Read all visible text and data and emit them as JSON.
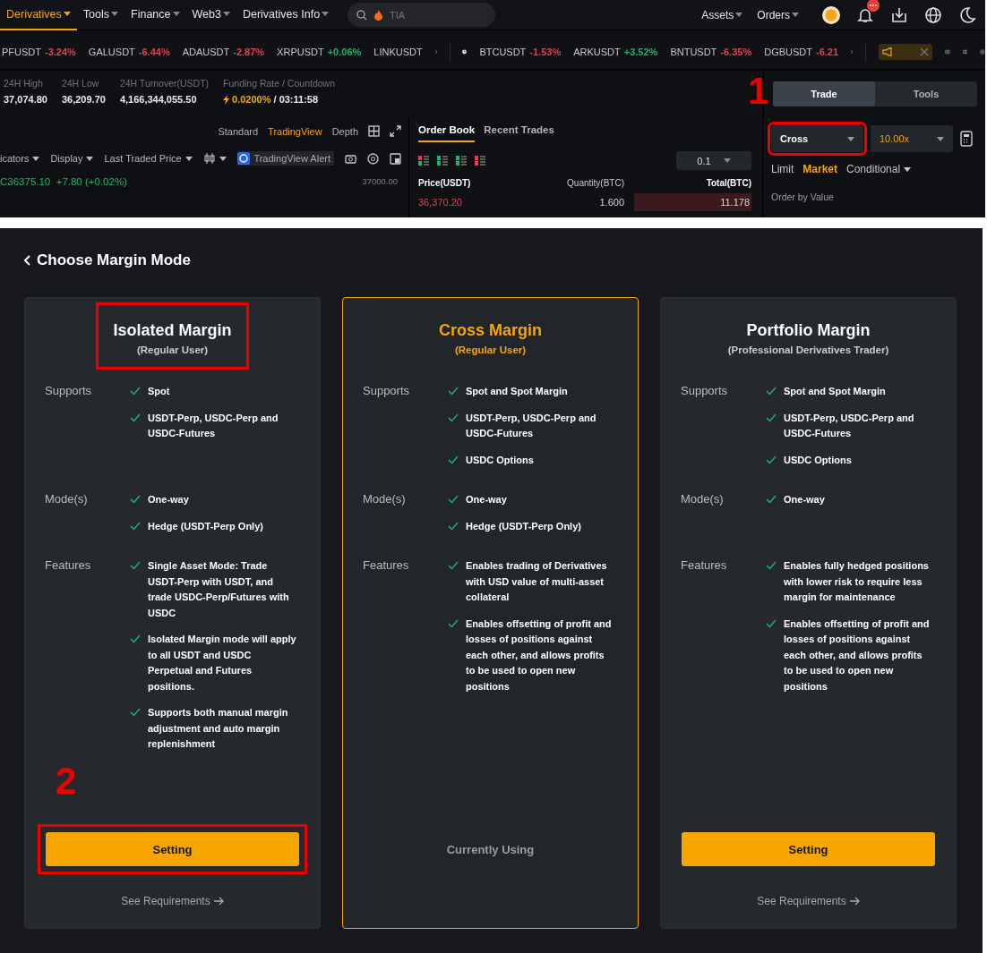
{
  "nav": {
    "menus": [
      {
        "label": "Derivatives",
        "selected": true
      },
      {
        "label": "Tools",
        "selected": false
      },
      {
        "label": "Finance",
        "selected": false
      },
      {
        "label": "Web3",
        "selected": false
      },
      {
        "label": "Derivatives Info",
        "selected": false
      }
    ],
    "search": {
      "placeholder": "TIA"
    },
    "right_menus": [
      {
        "label": "Assets"
      },
      {
        "label": "Orders"
      }
    ]
  },
  "ticker": {
    "items": [
      {
        "symbol": "PFUSDT",
        "change": "-3.24%",
        "color": "#e2404f"
      },
      {
        "symbol": "GALUSDT",
        "change": "-6.44%",
        "color": "#e2404f"
      },
      {
        "symbol": "ADAUSDT",
        "change": "-2.87%",
        "color": "#e2404f"
      },
      {
        "symbol": "XRPUSDT",
        "change": "+0.06%",
        "color": "#20b26c"
      },
      {
        "symbol": "LINKUSDT"
      }
    ],
    "pinned": [
      {
        "symbol": "BTCUSDT",
        "change": "-1.53%",
        "color": "#e2404f"
      },
      {
        "symbol": "ARKUSDT",
        "change": "+3.52%",
        "color": "#20b26c"
      },
      {
        "symbol": "BNTUSDT",
        "change": "-6.35%",
        "color": "#e2404f"
      },
      {
        "symbol": "DGBUSDT",
        "change": "-6.21",
        "color": "#e2404f"
      }
    ]
  },
  "stats": [
    {
      "label": "24H High",
      "value": "37,074.80"
    },
    {
      "label": "24H Low",
      "value": "36,209.70"
    },
    {
      "label": "24H Turnover(USDT)",
      "value": "4,166,344,055.50"
    }
  ],
  "funding": {
    "label": "Funding Rate / Countdown",
    "rate": "0.0200%",
    "countdown": "/ 03:11:58"
  },
  "chart": {
    "views": [
      {
        "label": "Standard",
        "selected": false
      },
      {
        "label": "TradingView",
        "selected": true
      },
      {
        "label": "Depth",
        "selected": false
      }
    ],
    "toolbar": [
      "icators",
      "Display",
      "Last Traded Price"
    ],
    "alert": "TradingView Alert",
    "close_label": "C",
    "close_value": "36375.10",
    "close_change": "+7.80 (+0.02%)",
    "axis_labels": [
      "37000.00"
    ]
  },
  "order_book": {
    "tabs": [
      {
        "label": "Order Book",
        "selected": true
      },
      {
        "label": "Recent Trades",
        "selected": false
      }
    ],
    "precision": "0.1",
    "columns": [
      "Price(USDT)",
      "Quantity(BTC)",
      "Total(BTC)"
    ],
    "rows": [
      {
        "price": "36,370.20",
        "quantity": "1.600",
        "total": "11.178"
      }
    ]
  },
  "order_panel": {
    "annotation": "1",
    "tabs": [
      {
        "label": "Trade",
        "selected": true
      },
      {
        "label": "Tools",
        "selected": false
      }
    ],
    "margin_mode": {
      "value": "Cross",
      "highlighted": true
    },
    "leverage": "10.00x",
    "order_types": [
      {
        "label": "Limit",
        "selected": false
      },
      {
        "label": "Market",
        "selected": true
      },
      {
        "label": "Conditional",
        "selected": false
      }
    ],
    "order_by": "Order by Value"
  },
  "margin_dialog": {
    "title": "Choose Margin Mode",
    "annotation": "2",
    "cards": [
      {
        "title": "Isolated Margin",
        "subtitle": "(Regular User)",
        "selected": false,
        "highlighted": true,
        "sections": [
          {
            "label": "Supports",
            "items": [
              "Spot",
              "USDT-Perp, USDC-Perp and USDC-Futures"
            ]
          },
          {
            "label": "Mode(s)",
            "items": [
              "One-way",
              "Hedge (USDT-Perp Only)"
            ]
          },
          {
            "label": "Features",
            "items": [
              "Single Asset Mode: Trade USDT-Perp with USDT, and trade USDC-Perp/Futures with USDC",
              "Isolated Margin mode will apply to all USDT and USDC Perpetual and Futures positions.",
              "Supports both manual margin adjustment and auto margin replenishment"
            ]
          }
        ],
        "action": {
          "kind": "button",
          "label": "Setting",
          "highlighted": true
        },
        "link": "See Requirements"
      },
      {
        "title": "Cross Margin",
        "subtitle": "(Regular User)",
        "selected": true,
        "highlighted": false,
        "sections": [
          {
            "label": "Supports",
            "items": [
              "Spot and Spot Margin",
              "USDT-Perp, USDC-Perp and USDC-Futures",
              "USDC Options"
            ]
          },
          {
            "label": "Mode(s)",
            "items": [
              "One-way",
              "Hedge (USDT-Perp Only)"
            ]
          },
          {
            "label": "Features",
            "items": [
              "Enables trading of Derivatives with USD value of multi-asset collateral",
              "Enables offsetting of profit and losses of positions against each other, and allows profits to be used to open new positions"
            ]
          }
        ],
        "action": {
          "kind": "status",
          "label": "Currently Using"
        }
      },
      {
        "title": "Portfolio Margin",
        "subtitle": "(Professional Derivatives Trader)",
        "selected": false,
        "highlighted": false,
        "sections": [
          {
            "label": "Supports",
            "items": [
              "Spot and Spot Margin",
              "USDT-Perp, USDC-Perp and USDC-Futures",
              "USDC Options"
            ]
          },
          {
            "label": "Mode(s)",
            "items": [
              "One-way"
            ]
          },
          {
            "label": "Features",
            "items": [
              "Enables fully hedged positions with lower risk to require less margin for maintenance",
              "Enables offsetting of profit and losses of positions against each other, and allows profits to be used to open new positions"
            ]
          }
        ],
        "action": {
          "kind": "button",
          "label": "Setting",
          "highlighted": false
        },
        "link": "See Requirements"
      }
    ]
  }
}
